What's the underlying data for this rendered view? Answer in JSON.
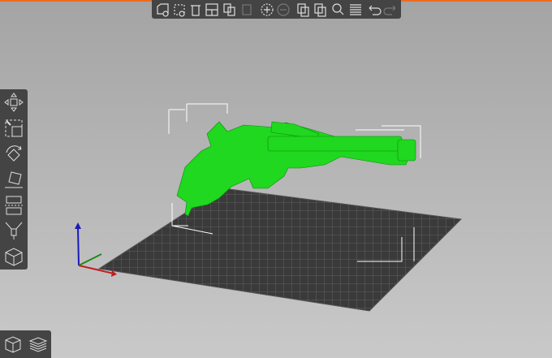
{
  "colors": {
    "accent": "#ed6b21",
    "model": "#1fd81f",
    "toolbar": "#444444",
    "bed": "#3a3a3a"
  },
  "top_toolbar": [
    "add-icon",
    "delete-icon",
    "delete-all-icon",
    "arrange-icon",
    "copy-icon",
    "paste-icon",
    "add-instance-icon",
    "remove-instance-icon",
    "split-objects-icon",
    "split-parts-icon",
    "search-icon",
    "layers-icon",
    "undo-icon",
    "redo-icon"
  ],
  "left_toolbar": [
    "move-icon",
    "scale-icon",
    "rotate-icon",
    "place-on-face-icon",
    "cut-icon",
    "support-paint-icon",
    "hollow-icon"
  ],
  "view_toggle": [
    "3d-view-icon",
    "preview-icon"
  ]
}
